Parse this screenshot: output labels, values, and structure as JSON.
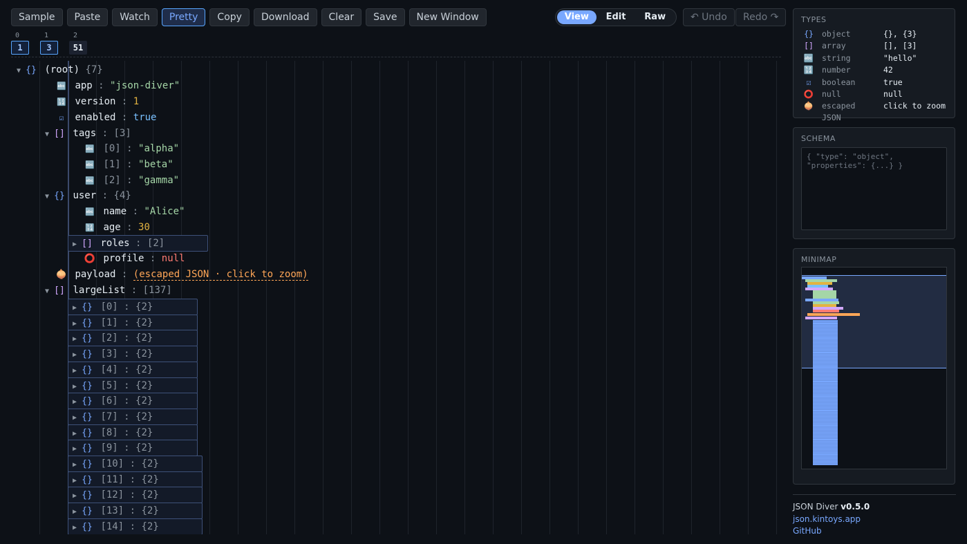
{
  "toolbar": {
    "buttons": [
      "Sample",
      "Paste",
      "Watch",
      "Pretty",
      "Copy",
      "Download",
      "Clear",
      "Save",
      "New Window"
    ],
    "active": "Pretty"
  },
  "mode": {
    "options": [
      "View",
      "Edit",
      "Raw"
    ],
    "selected": "View"
  },
  "history": {
    "undo": "↶ Undo",
    "redo": "Redo ↷"
  },
  "depth_bar": [
    {
      "level": "0",
      "count": "1"
    },
    {
      "level": "1",
      "count": "3"
    },
    {
      "level": "2",
      "count": "51"
    }
  ],
  "tree": {
    "root": {
      "icon": "{}",
      "label": "(root)",
      "count": "{7}"
    },
    "app": {
      "icon": "🔤",
      "key": "app",
      "value": "\"json-diver\""
    },
    "version": {
      "icon": "🔢",
      "key": "version",
      "value": "1"
    },
    "enabled": {
      "icon": "☑",
      "key": "enabled",
      "value": "true"
    },
    "tags": {
      "icon": "[]",
      "key": "tags",
      "count": "[3]"
    },
    "tags_items": [
      {
        "icon": "🔤",
        "key": "[0]",
        "value": "\"alpha\""
      },
      {
        "icon": "🔤",
        "key": "[1]",
        "value": "\"beta\""
      },
      {
        "icon": "🔤",
        "key": "[2]",
        "value": "\"gamma\""
      }
    ],
    "user": {
      "icon": "{}",
      "key": "user",
      "count": "{4}"
    },
    "user_name": {
      "icon": "🔤",
      "key": "name",
      "value": "\"Alice\""
    },
    "user_age": {
      "icon": "🔢",
      "key": "age",
      "value": "30"
    },
    "user_roles": {
      "icon": "[]",
      "key": "roles",
      "count": "[2]"
    },
    "user_profile": {
      "icon": "⭕",
      "key": "profile",
      "value": "null"
    },
    "payload": {
      "icon": "🧅",
      "key": "payload",
      "value": "(escaped JSON · click to zoom)"
    },
    "largeList": {
      "icon": "[]",
      "key": "largeList",
      "count": "[137]"
    },
    "largeList_items": [
      {
        "icon": "{}",
        "key": "[0]",
        "count": "{2}"
      },
      {
        "icon": "{}",
        "key": "[1]",
        "count": "{2}"
      },
      {
        "icon": "{}",
        "key": "[2]",
        "count": "{2}"
      },
      {
        "icon": "{}",
        "key": "[3]",
        "count": "{2}"
      },
      {
        "icon": "{}",
        "key": "[4]",
        "count": "{2}"
      },
      {
        "icon": "{}",
        "key": "[5]",
        "count": "{2}"
      },
      {
        "icon": "{}",
        "key": "[6]",
        "count": "{2}"
      },
      {
        "icon": "{}",
        "key": "[7]",
        "count": "{2}"
      },
      {
        "icon": "{}",
        "key": "[8]",
        "count": "{2}"
      },
      {
        "icon": "{}",
        "key": "[9]",
        "count": "{2}"
      },
      {
        "icon": "{}",
        "key": "[10]",
        "count": "{2}"
      },
      {
        "icon": "{}",
        "key": "[11]",
        "count": "{2}"
      },
      {
        "icon": "{}",
        "key": "[12]",
        "count": "{2}"
      },
      {
        "icon": "{}",
        "key": "[13]",
        "count": "{2}"
      },
      {
        "icon": "{}",
        "key": "[14]",
        "count": "{2}"
      }
    ]
  },
  "types_panel": {
    "title": "TYPES",
    "rows": [
      {
        "icon": "{}",
        "name": "object",
        "example": "{}, {3}"
      },
      {
        "icon": "[]",
        "name": "array",
        "example": "[], [3]"
      },
      {
        "icon": "🔤",
        "name": "string",
        "example": "\"hello\""
      },
      {
        "icon": "🔢",
        "name": "number",
        "example": "42"
      },
      {
        "icon": "☑",
        "name": "boolean",
        "example": "true"
      },
      {
        "icon": "⭕",
        "name": "null",
        "example": "null"
      },
      {
        "icon": "🧅",
        "name": "escaped JSON",
        "example": "click to zoom"
      }
    ]
  },
  "schema_panel": {
    "title": "SCHEMA",
    "placeholder": "{ \"type\": \"object\", \"properties\": {...} }"
  },
  "minimap_panel": {
    "title": "MINIMAP"
  },
  "footer": {
    "app_name": "JSON Diver",
    "version": "v0.5.0",
    "site": "json.kintoys.app",
    "github": "GitHub"
  },
  "colors": {
    "accent": "#79a8ff",
    "string": "#a5d6a7",
    "number": "#e3b341",
    "null": "#ff7b72",
    "escaped": "#ffa657"
  }
}
